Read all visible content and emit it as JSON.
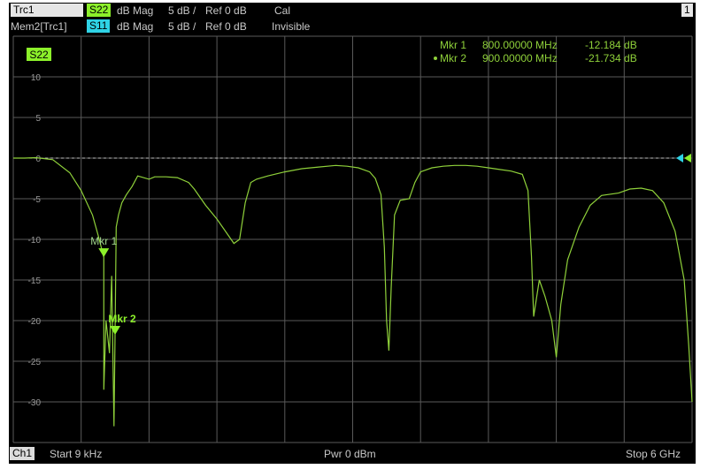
{
  "header": {
    "row1": {
      "trace": "Trc1",
      "param": "S22",
      "format": "dB Mag",
      "scale": "5 dB /",
      "ref": "Ref 0 dB",
      "status": "Cal",
      "window_number": "1"
    },
    "row2": {
      "trace": "Mem2[Trc1]",
      "param": "S11",
      "format": "dB Mag",
      "scale": "5 dB /",
      "ref": "Ref 0 dB",
      "status": "Invisible"
    }
  },
  "trace_label": "S22",
  "markers": [
    {
      "label": "Mkr 1",
      "freq": "800.00000 MHz",
      "value": "-12.184 dB"
    },
    {
      "label": "Mkr 2",
      "freq": "900.00000 MHz",
      "value": "-21.734 dB"
    }
  ],
  "footer": {
    "channel": "Ch1",
    "start": "Start  9 kHz",
    "power": "Pwr  0 dBm",
    "stop": "Stop  6 GHz"
  },
  "colors": {
    "trace": "#8fd13a",
    "s22_bg": "#8cf02a",
    "s11_bg": "#2fd3e6",
    "grid": "#5a5a5a",
    "ref_line": "#c0c0c0",
    "background": "#000000"
  },
  "chart_data": {
    "type": "line",
    "x_unit": "GHz",
    "y_unit": "dB",
    "xlim": [
      9e-06,
      6
    ],
    "ylim": [
      -35,
      15
    ],
    "y_ticks": [
      10,
      5,
      0,
      -5,
      -10,
      -15,
      -20,
      -25,
      -30
    ],
    "grid": true,
    "reference_level": 0,
    "series": [
      {
        "name": "S22",
        "points": [
          [
            9e-06,
            0.0
          ],
          [
            0.05,
            0.0
          ],
          [
            0.1,
            0.0
          ],
          [
            0.2,
            0.05
          ],
          [
            0.35,
            -0.2
          ],
          [
            0.5,
            -1.8
          ],
          [
            0.6,
            -4.0
          ],
          [
            0.7,
            -7.0
          ],
          [
            0.75,
            -9.5
          ],
          [
            0.8,
            -12.2
          ],
          [
            0.8,
            -28.5
          ],
          [
            0.82,
            -20.0
          ],
          [
            0.85,
            -24.0
          ],
          [
            0.87,
            -14.5
          ],
          [
            0.89,
            -33.0
          ],
          [
            0.9,
            -21.7
          ],
          [
            0.91,
            -8.5
          ],
          [
            0.93,
            -7.0
          ],
          [
            0.96,
            -5.5
          ],
          [
            1.0,
            -4.5
          ],
          [
            1.05,
            -3.5
          ],
          [
            1.1,
            -2.2
          ],
          [
            1.2,
            -2.6
          ],
          [
            1.25,
            -2.3
          ],
          [
            1.35,
            -2.3
          ],
          [
            1.45,
            -2.4
          ],
          [
            1.55,
            -3.0
          ],
          [
            1.6,
            -3.8
          ],
          [
            1.7,
            -5.8
          ],
          [
            1.8,
            -7.5
          ],
          [
            1.9,
            -9.5
          ],
          [
            1.95,
            -10.5
          ],
          [
            2.0,
            -10.0
          ],
          [
            2.05,
            -5.5
          ],
          [
            2.1,
            -3.0
          ],
          [
            2.15,
            -2.6
          ],
          [
            2.25,
            -2.2
          ],
          [
            2.4,
            -1.7
          ],
          [
            2.55,
            -1.3
          ],
          [
            2.7,
            -1.1
          ],
          [
            2.85,
            -0.9
          ],
          [
            2.95,
            -1.0
          ],
          [
            3.05,
            -1.2
          ],
          [
            3.15,
            -1.7
          ],
          [
            3.2,
            -2.5
          ],
          [
            3.25,
            -4.5
          ],
          [
            3.28,
            -11.0
          ],
          [
            3.3,
            -20.0
          ],
          [
            3.32,
            -23.7
          ],
          [
            3.34,
            -16.0
          ],
          [
            3.37,
            -7.0
          ],
          [
            3.42,
            -5.2
          ],
          [
            3.5,
            -5.0
          ],
          [
            3.55,
            -3.0
          ],
          [
            3.6,
            -1.7
          ],
          [
            3.7,
            -1.2
          ],
          [
            3.8,
            -1.0
          ],
          [
            3.9,
            -0.9
          ],
          [
            4.0,
            -0.9
          ],
          [
            4.1,
            -1.0
          ],
          [
            4.2,
            -1.2
          ],
          [
            4.3,
            -1.4
          ],
          [
            4.4,
            -1.6
          ],
          [
            4.5,
            -2.0
          ],
          [
            4.55,
            -4.0
          ],
          [
            4.58,
            -12.0
          ],
          [
            4.6,
            -19.5
          ],
          [
            4.65,
            -15.0
          ],
          [
            4.7,
            -17.0
          ],
          [
            4.76,
            -20.0
          ],
          [
            4.8,
            -24.5
          ],
          [
            4.84,
            -18.0
          ],
          [
            4.9,
            -12.5
          ],
          [
            5.0,
            -8.5
          ],
          [
            5.1,
            -5.8
          ],
          [
            5.2,
            -4.6
          ],
          [
            5.35,
            -4.3
          ],
          [
            5.45,
            -3.8
          ],
          [
            5.55,
            -3.7
          ],
          [
            5.65,
            -4.0
          ],
          [
            5.75,
            -5.5
          ],
          [
            5.85,
            -9.0
          ],
          [
            5.93,
            -15.0
          ],
          [
            5.97,
            -23.0
          ],
          [
            6.0,
            -30.0
          ]
        ]
      }
    ],
    "markers": [
      {
        "label": "Mkr 1",
        "x": 0.8,
        "y": -12.184
      },
      {
        "label": "Mkr 2",
        "x": 0.9,
        "y": -21.734
      }
    ]
  }
}
